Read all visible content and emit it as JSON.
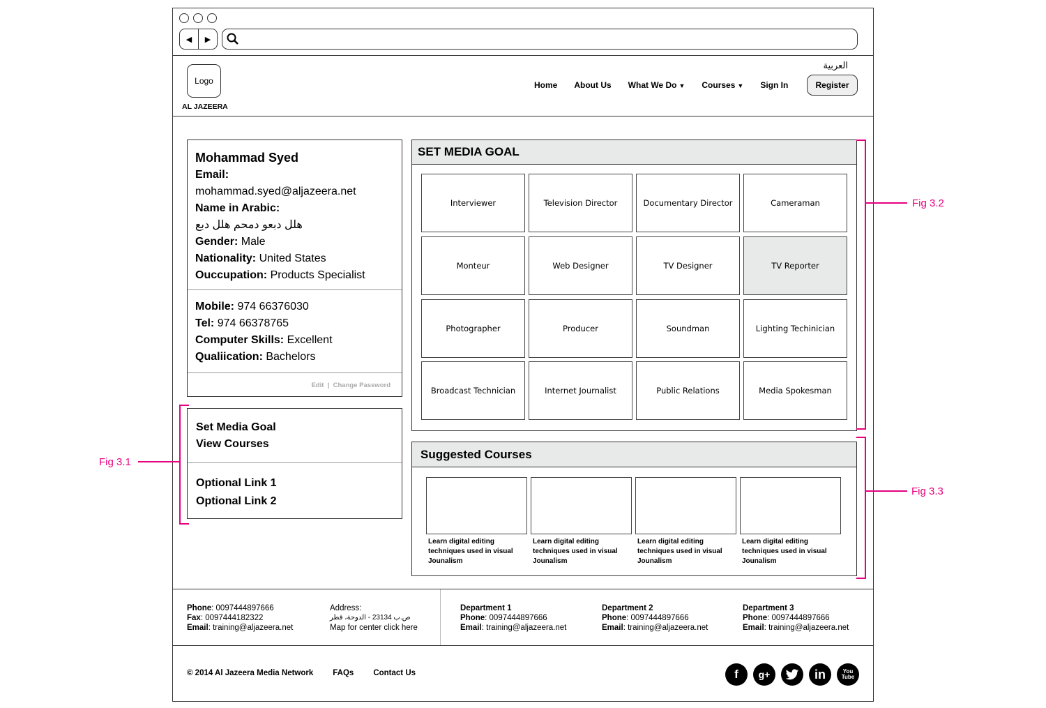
{
  "header": {
    "logo": "Logo",
    "brand": "AL JAZEERA",
    "language": "العربية",
    "nav": [
      "Home",
      "About Us",
      "What We Do",
      "Courses",
      "Sign In"
    ],
    "register": "Register"
  },
  "profile": {
    "name": "Mohammad Syed",
    "email_label": "Email:",
    "email": "mohammad.syed@aljazeera.net",
    "arabic_label": "Name in Arabic:",
    "arabic_name": "هلل دبعو دمحم هلل دبع",
    "gender_label": "Gender:",
    "gender": "Male",
    "nationality_label": "Nationality:",
    "nationality": "United States",
    "occupation_label": "Ouccupation:",
    "occupation": "Products Specialist",
    "mobile_label": "Mobile:",
    "mobile": "974 66376030",
    "tel_label": "Tel:",
    "tel": "974 66378765",
    "skills_label": "Computer Skills:",
    "skills": "Excellent",
    "qualification_label": "Qualiication:",
    "qualification": "Bachelors",
    "edit": "Edit",
    "change_password": "Change Password"
  },
  "links": {
    "primary": [
      "Set Media Goal",
      "View Courses"
    ],
    "optional": [
      "Optional Link 1",
      "Optional Link 2"
    ]
  },
  "media_goal": {
    "title": "SET MEDIA GOAL",
    "selected": "TV Reporter",
    "tiles": [
      "Interviewer",
      "Television Director",
      "Documentary Director",
      "Cameraman",
      "Monteur",
      "Web Designer",
      "TV Designer",
      "TV Reporter",
      "Photographer",
      "Producer",
      "Soundman",
      "Lighting Techinician",
      "Broadcast Technician",
      "Internet Journalist",
      "Public Relations",
      "Media Spokesman"
    ]
  },
  "suggested": {
    "title": "Suggested Courses",
    "courses": [
      "Learn digital editing techniques used in visual Jounalism",
      "Learn digital editing techniques used in visual Jounalism",
      "Learn digital editing techniques used in visual Jounalism",
      "Learn digital editing techniques used in visual Jounalism"
    ]
  },
  "footer": {
    "phone_label": "Phone",
    "phone": "0097444897666",
    "fax_label": "Fax",
    "fax": "0097444182322",
    "email_label": "Email",
    "email": "training@aljazeera.net",
    "address_label": "Address",
    "address_line": "ص.ب 23134 - الدوحة، قطر",
    "map": "Map for center click here",
    "departments": [
      {
        "name": "Department 1",
        "phone": "0097444897666",
        "email": "training@aljazeera.net"
      },
      {
        "name": "Department 2",
        "phone": "0097444897666",
        "email": "training@aljazeera.net"
      },
      {
        "name": "Department 3",
        "phone": "0097444897666",
        "email": "training@aljazeera.net"
      }
    ],
    "copyright": "© 2014 Al Jazeera Media Network",
    "faqs": "FAQs",
    "contact": "Contact Us",
    "social": [
      "f",
      "g+",
      "t",
      "in",
      "You Tube"
    ]
  },
  "annotations": {
    "fig1": "Fig 3.1",
    "fig2": "Fig 3.2",
    "fig3": "Fig 3.3"
  },
  "colors": {
    "annotation": "#e6007e",
    "panel_header": "#e8e9e9",
    "selected_tile": "#e8e9e9"
  }
}
